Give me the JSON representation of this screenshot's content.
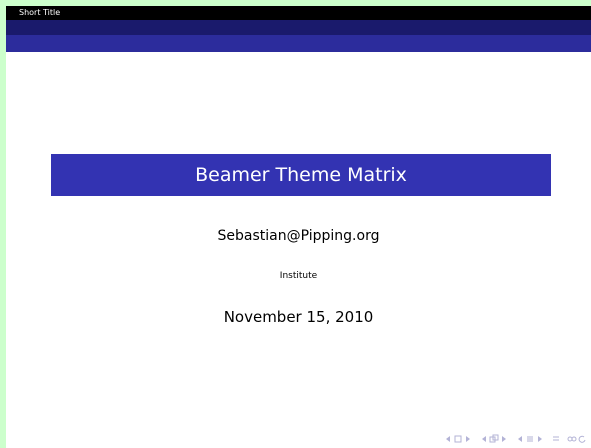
{
  "header": {
    "short_title": "Short Title"
  },
  "title_page": {
    "title": "Beamer Theme Matrix",
    "author": "Sebastian@Pipping.org",
    "institute": "Institute",
    "date": "November 15, 2010"
  },
  "navigation": {
    "icons": [
      "nav-frame-prev-icon",
      "nav-frame-next-icon",
      "nav-subsection-prev-icon",
      "nav-subsection-next-icon",
      "nav-section-prev-icon",
      "nav-section-next-icon",
      "nav-slide-icon",
      "nav-search-icon"
    ]
  },
  "colors": {
    "background": "#ccffcc",
    "headline": "#000000",
    "bar_mid": "#1a1a6c",
    "bar_low": "#2c2c9c",
    "title_box": "#3333b2",
    "nav": "#b3b3d6"
  }
}
